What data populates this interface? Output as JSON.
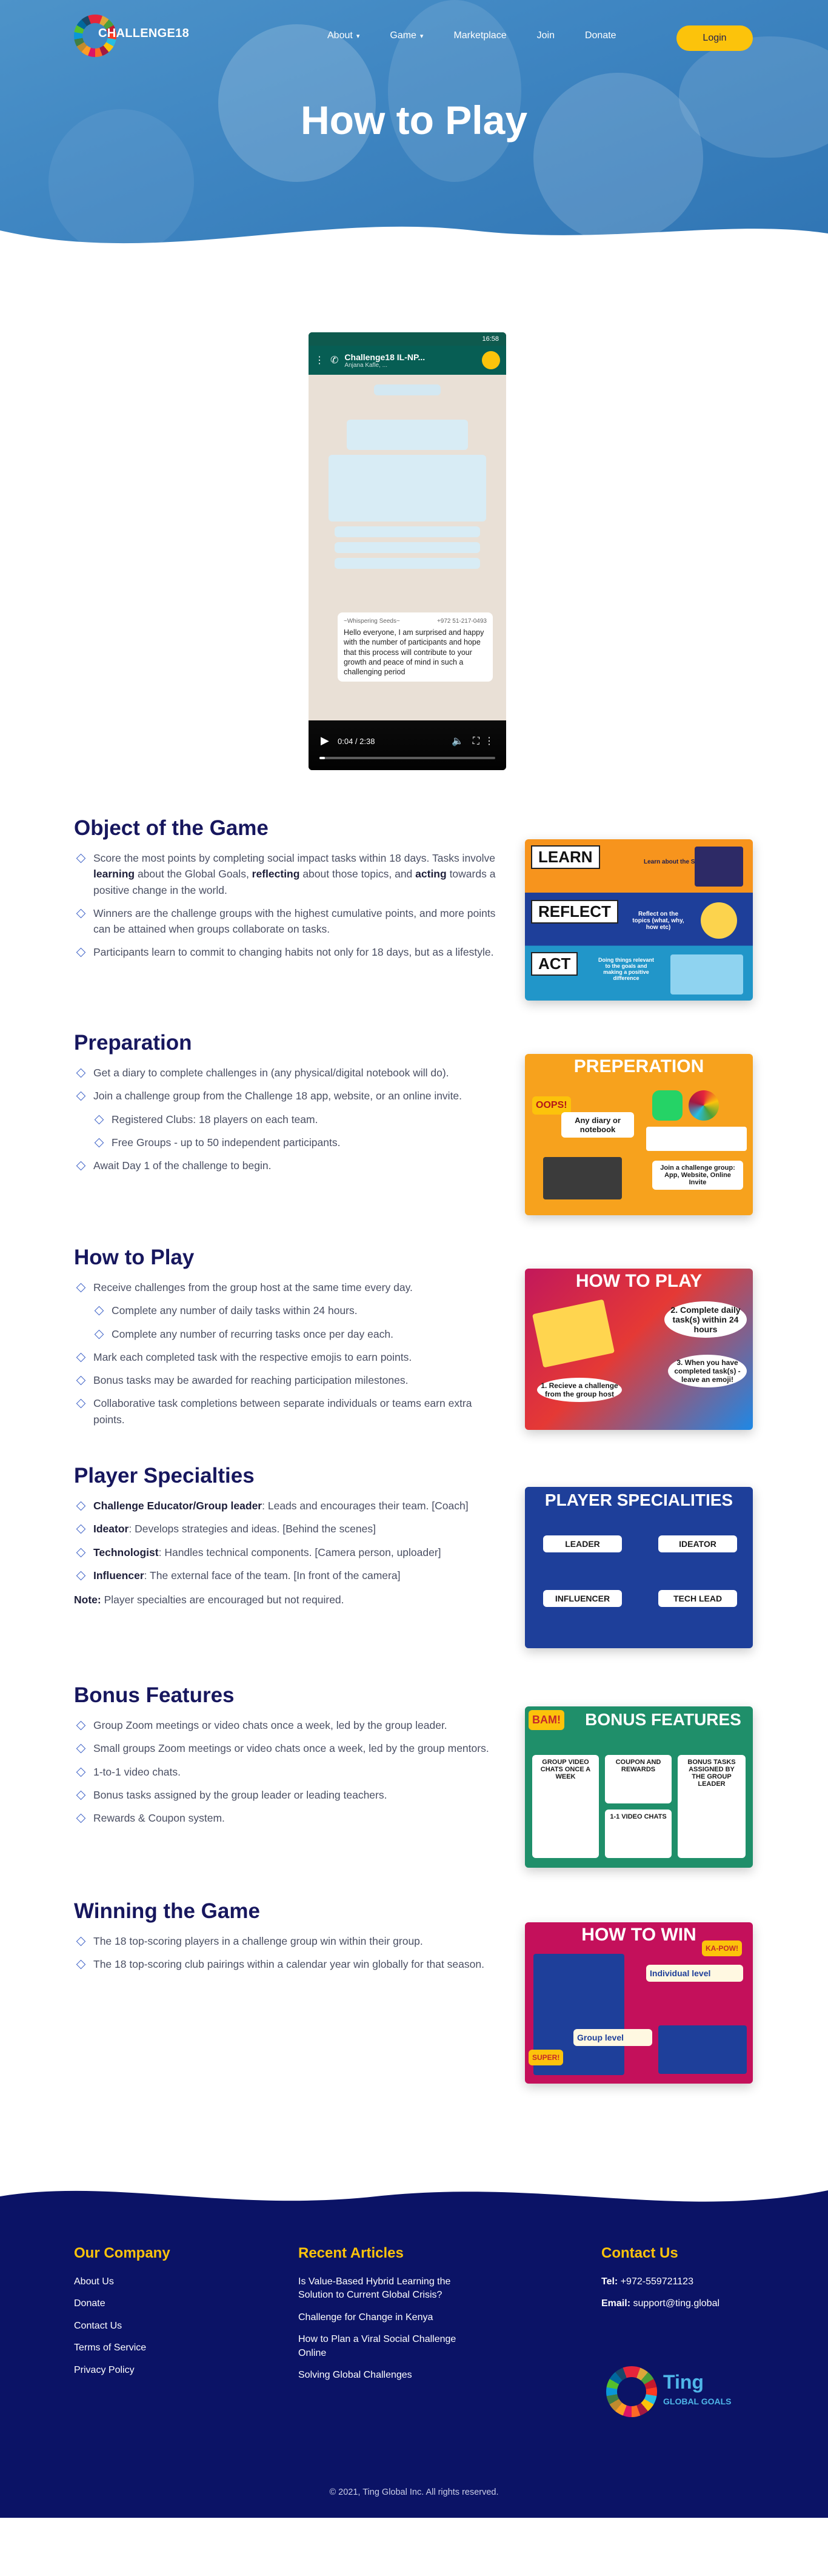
{
  "nav": {
    "logo_text": "CHALLENGE18",
    "items": [
      {
        "label": "About",
        "has_dropdown": true
      },
      {
        "label": "Game",
        "has_dropdown": true
      },
      {
        "label": "Marketplace",
        "has_dropdown": false
      },
      {
        "label": "Join",
        "has_dropdown": false
      },
      {
        "label": "Donate",
        "has_dropdown": false
      }
    ],
    "login_label": "Login"
  },
  "hero": {
    "title": "How to Play"
  },
  "video": {
    "status_time": "16:58",
    "chat_title": "Challenge18 IL-NP...",
    "chat_subtitle": "Anjana Kafle, ...",
    "message_sender": "~Whispering Seeds~",
    "message_phone": "+972 51-217-0493",
    "message_text": "Hello everyone, I am surprised and happy with the number of participants and hope that this process will contribute to your growth and peace of mind in such a challenging period",
    "time_label": "0:04 / 2:38",
    "progress": 0.03
  },
  "sections": {
    "objective": {
      "title": "Object of the Game",
      "items": [
        "Score the most points by completing social impact tasks within 18 days. Tasks involve learning about the Global Goals, reflecting about those topics, and acting towards a positive change in the world.",
        "Winners are the challenge groups with the highest cumulative points, and more points can be attained when groups collaborate on tasks.",
        "Participants learn to commit to changing habits not only for 18 days, but as a lifestyle."
      ],
      "card": {
        "words": [
          "LEARN",
          "REFLECT",
          "ACT"
        ],
        "captions": [
          "Learn about the SDG goals",
          "Reflect on the topics (what, why, how etc)",
          "Doing things relevant to the goals and making a positive difference"
        ]
      }
    },
    "preparation": {
      "title": "Preparation",
      "items": [
        "Get a diary to complete challenges in (any physical/digital notebook will do).",
        "Join a challenge group from the Challenge 18 app, website, or an online invite."
      ],
      "sub_items": [
        "Registered Clubs: 18 players on each team.",
        "Free Groups - up to 50 independent participants."
      ],
      "last_item": "Await Day 1 of the challenge to begin.",
      "card": {
        "title": "PREPERATION",
        "bubble": "Any diary or notebook",
        "join": "Join a challenge group: App, Website, Online Invite",
        "exclaim": "OOPS!"
      }
    },
    "howtoplay": {
      "title": "How to Play",
      "item1": "Receive challenges from the group host at the same time every day.",
      "sub_items": [
        "Complete any number of daily tasks within 24 hours.",
        "Complete any number of recurring tasks once per day each."
      ],
      "items": [
        "Mark each completed task with the respective emojis to earn points.",
        "Bonus tasks may be awarded for reaching participation milestones.",
        "Collaborative task completions between separate individuals or teams earn extra points."
      ],
      "card": {
        "title": "HOW TO PLAY",
        "step1": "1. Recieve a challenge from the group host",
        "step2": "2. Complete daily task(s) within 24 hours",
        "step3": "3. When you have completed task(s) - leave an emoji!"
      }
    },
    "specialties": {
      "title": "Player Specialties",
      "items": [
        {
          "bold": "Challenge Educator/Group leader",
          "text": ": Leads and encourages their team. [Coach]"
        },
        {
          "bold": "Ideator",
          "text": ": Develops strategies and ideas. [Behind the scenes]"
        },
        {
          "bold": "Technologist",
          "text": ": Handles technical components. [Camera person, uploader]"
        },
        {
          "bold": "Influencer",
          "text": ": The external face of the team. [In front of the camera]"
        }
      ],
      "note_label": "Note:",
      "note_text": " Player specialties are encouraged but not required.",
      "card": {
        "title": "PLAYER SPECIALITIES",
        "roles": [
          "LEADER",
          "IDEATOR",
          "INFLUENCER",
          "TECH LEAD"
        ]
      }
    },
    "bonus": {
      "title": "Bonus Features",
      "items": [
        "Group Zoom meetings or video chats once a week, led by the group leader.",
        "Small groups Zoom meetings or video chats once a week, led by the group mentors.",
        "1-to-1 video chats.",
        "Bonus tasks assigned by the group leader or leading teachers.",
        "Rewards & Coupon system."
      ],
      "card": {
        "title": "BONUS FEATURES",
        "bam": "BAM!",
        "boxes": [
          "GROUP VIDEO CHATS ONCE A WEEK",
          "COUPON AND REWARDS",
          "BONUS TASKS ASSIGNED BY THE GROUP LEADER",
          "1-1 VIDEO CHATS"
        ]
      }
    },
    "winning": {
      "title": "Winning the Game",
      "items": [
        "The 18 top-scoring players in a challenge group win within their group.",
        "The 18 top-scoring club pairings within a calendar year win globally for that season."
      ],
      "card": {
        "title": "HOW TO WIN",
        "kapow": "KA-POW!",
        "super": "SUPER!",
        "individual": "Individual level",
        "group": "Group level"
      }
    }
  },
  "footer": {
    "company": {
      "title": "Our Company",
      "links": [
        "About Us",
        "Donate",
        "Contact Us",
        "Terms of Service",
        "Privacy Policy"
      ]
    },
    "articles": {
      "title": "Recent Articles",
      "links": [
        "Is Value-Based Hybrid Learning the Solution to Current Global Crisis?",
        "Challenge for Change in Kenya",
        "How to Plan a Viral Social Challenge Online",
        "Solving Global Challenges"
      ]
    },
    "contact": {
      "title": "Contact Us",
      "tel_label": "Tel:",
      "tel": " +972-559721123",
      "email_label": "Email:",
      "email": " support@ting.global"
    },
    "ting_logo": {
      "name": "Ting",
      "sub": "GLOBAL GOALS"
    },
    "copyright": "© 2021, Ting Global Inc. All rights reserved."
  },
  "colors": {
    "hero_blue": "#3f86c2",
    "accent_yellow": "#fcc30b",
    "heading_navy": "#17175e",
    "footer_navy": "#0b1366",
    "bullet_blue": "#3a5fc6"
  }
}
